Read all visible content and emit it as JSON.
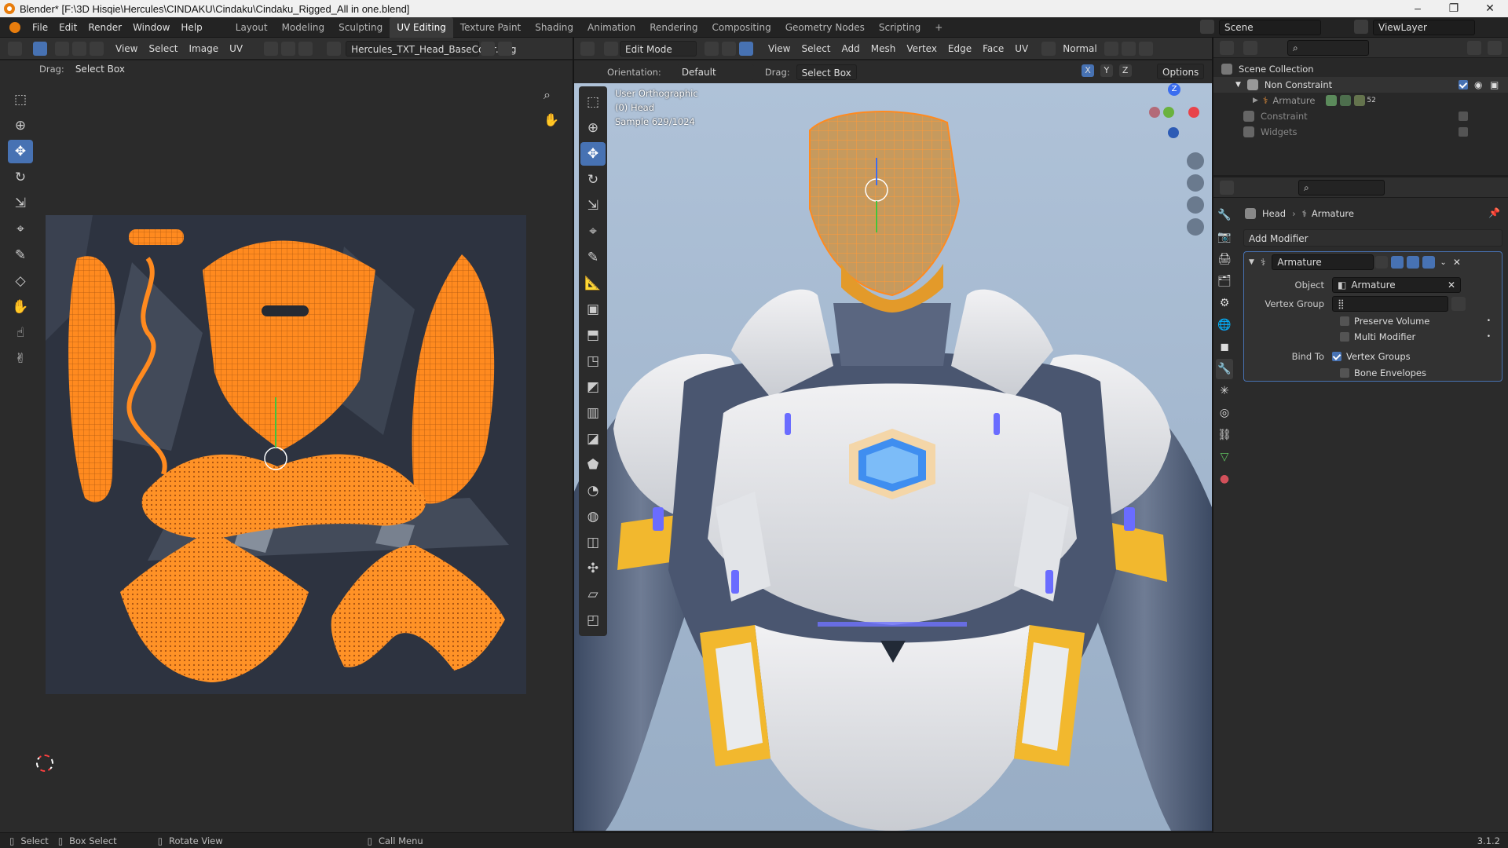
{
  "window": {
    "title": "Blender* [F:\\3D Hisqie\\Hercules\\CINDAKU\\Cindaku\\Cindaku_Rigged_All in one.blend]",
    "minimize": "–",
    "maximize": "❐",
    "close": "✕"
  },
  "topbar": {
    "menus": [
      "File",
      "Edit",
      "Render",
      "Window",
      "Help"
    ],
    "workspaces": [
      "Layout",
      "Modeling",
      "Sculpting",
      "UV Editing",
      "Texture Paint",
      "Shading",
      "Animation",
      "Rendering",
      "Compositing",
      "Geometry Nodes",
      "Scripting",
      "+"
    ],
    "active_workspace": "UV Editing",
    "scene": "Scene",
    "view_layer": "ViewLayer"
  },
  "uv_editor": {
    "menus": [
      "View",
      "Select",
      "Image",
      "UV"
    ],
    "image_name": "Hercules_TXT_Head_BaseColor.png",
    "drag_label": "Drag:",
    "drag_value": "Select Box"
  },
  "viewport": {
    "mode": "Edit Mode",
    "menus": [
      "View",
      "Select",
      "Add",
      "Mesh",
      "Vertex",
      "Edge",
      "Face",
      "UV"
    ],
    "transform_orientation": "Normal",
    "orientation_label": "Orientation:",
    "orientation_value": "Default",
    "drag_label": "Drag:",
    "drag_value": "Select Box",
    "options": "Options",
    "axes": [
      "X",
      "Y",
      "Z"
    ],
    "overlay_lines": [
      "User Orthographic",
      "(0) Head",
      "Sample 629/1024"
    ],
    "gizmo_z": "Z"
  },
  "outliner": {
    "title": "Scene Collection",
    "items": [
      {
        "label": "Non Constraint",
        "level": 1
      },
      {
        "label": "Armature",
        "level": 2,
        "badge": "52"
      },
      {
        "label": "Constraint",
        "level": 1
      },
      {
        "label": "Widgets",
        "level": 1
      }
    ]
  },
  "properties": {
    "breadcrumb": [
      "Head",
      "Armature"
    ],
    "add_modifier": "Add Modifier",
    "modifier_name": "Armature",
    "object_label": "Object",
    "object_value": "Armature",
    "vertex_group_label": "Vertex Group",
    "preserve_volume": "Preserve Volume",
    "multi_modifier": "Multi Modifier",
    "bind_to_label": "Bind To",
    "vertex_groups": "Vertex Groups",
    "bone_envelopes": "Bone Envelopes"
  },
  "statusbar": {
    "items": [
      "Select",
      "Box Select",
      "Rotate View",
      "Call Menu"
    ],
    "version": "3.1.2"
  },
  "colors": {
    "accent": "#4772b3",
    "uv_orange": "#ff8a1f",
    "viewport_bg": "#a9bcd3"
  }
}
